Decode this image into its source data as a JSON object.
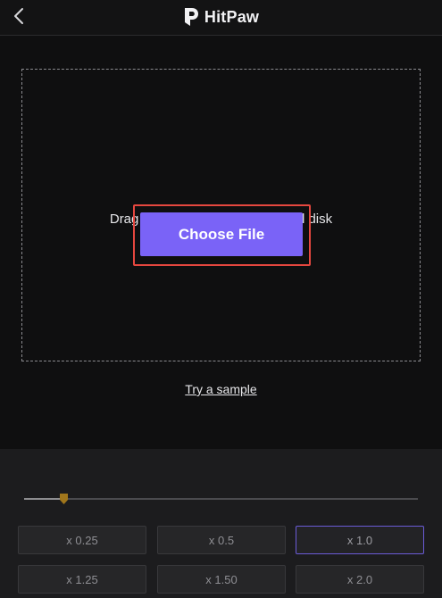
{
  "header": {
    "brand_name": "HitPaw",
    "back_icon": "chevron-left-icon",
    "logo_icon": "hitpaw-logo-icon"
  },
  "upload": {
    "drop_text": "Drag and drop from Files or local disk",
    "choose_file_label": "Choose File",
    "try_sample_label": "Try a sample"
  },
  "controls": {
    "slider_value_fraction": 0.1,
    "speed_options": [
      {
        "label": "x 0.25",
        "selected": false
      },
      {
        "label": "x 0.5",
        "selected": false
      },
      {
        "label": "x 1.0",
        "selected": true
      },
      {
        "label": "x 1.25",
        "selected": false
      },
      {
        "label": "x 1.50",
        "selected": false
      },
      {
        "label": "x 2.0",
        "selected": false
      }
    ]
  },
  "colors": {
    "accent": "#7a63f7",
    "highlight_outline": "#e5473f",
    "slider_thumb": "#a0761c",
    "selected_border": "#6a5bd6"
  }
}
